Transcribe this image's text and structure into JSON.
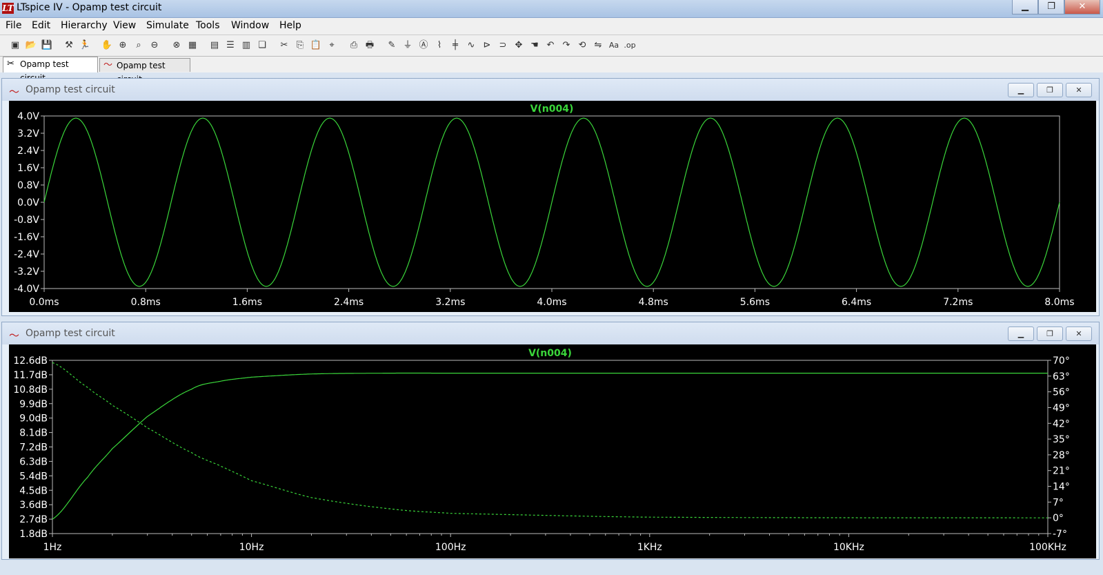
{
  "window": {
    "title": "LTspice IV - Opamp test circuit",
    "logo": "LT"
  },
  "window_buttons": [
    "▁",
    "❐",
    "✕"
  ],
  "menu": [
    "File",
    "Edit",
    "Hierarchy",
    "View",
    "Simulate",
    "Tools",
    "Window",
    "Help"
  ],
  "toolbar_icons": [
    "new-schematic-icon",
    "open-icon",
    "save-icon",
    "control-panel-icon",
    "run-icon",
    "halt-icon",
    "zoom-in-icon",
    "pan-icon",
    "zoom-out-icon",
    "zoom-fit-icon",
    "autorange-icon",
    "grid-icon",
    "tile-horizontal-icon",
    "tile-vertical-icon",
    "cascade-icon",
    "cut-icon",
    "copy-icon",
    "paste-icon",
    "find-icon",
    "print-preview-icon",
    "print-icon",
    "wire-icon",
    "ground-icon",
    "label-icon",
    "resistor-icon",
    "capacitor-icon",
    "inductor-icon",
    "diode-icon",
    "component-icon",
    "move-icon",
    "drag-icon",
    "undo-icon",
    "redo-icon",
    "rotate-icon",
    "mirror-icon",
    "text-icon",
    "spice-directive-icon"
  ],
  "tabs": [
    {
      "label": "Opamp test circuit"
    },
    {
      "label": "Opamp test circuit"
    }
  ],
  "panes": [
    {
      "title": "Opamp test circuit"
    },
    {
      "title": "Opamp test circuit"
    }
  ],
  "pane_buttons": [
    "▁",
    "❐",
    "✕"
  ],
  "chart_data": [
    {
      "type": "line",
      "title": "V(n004)",
      "x_ticks": [
        "0.0ms",
        "0.8ms",
        "1.6ms",
        "2.4ms",
        "3.2ms",
        "4.0ms",
        "4.8ms",
        "5.6ms",
        "6.4ms",
        "7.2ms",
        "8.0ms"
      ],
      "y_ticks": [
        "4.0V",
        "3.2V",
        "2.4V",
        "1.6V",
        "0.8V",
        "0.0V",
        "-0.8V",
        "-1.6V",
        "-2.4V",
        "-3.2V",
        "-4.0V"
      ],
      "xlim": [
        0,
        8
      ],
      "ylim": [
        -4,
        4
      ],
      "series": [
        {
          "name": "V(n004)",
          "amplitude": 3.9,
          "frequency_khz": 1,
          "color": "#3ad63a"
        }
      ],
      "grid": false
    },
    {
      "type": "line",
      "title": "V(n004)",
      "x_scale": "log",
      "x_ticks": [
        "1Hz",
        "10Hz",
        "100Hz",
        "1KHz",
        "10KHz",
        "100KHz"
      ],
      "y_ticks": [
        "12.6dB",
        "11.7dB",
        "10.8dB",
        "9.9dB",
        "9.0dB",
        "8.1dB",
        "7.2dB",
        "6.3dB",
        "5.4dB",
        "4.5dB",
        "3.6dB",
        "2.7dB",
        "1.8dB"
      ],
      "y2_ticks": [
        "70°",
        "63°",
        "56°",
        "49°",
        "42°",
        "35°",
        "28°",
        "21°",
        "14°",
        "7°",
        "0°",
        "-7°"
      ],
      "xlim": [
        1,
        100000
      ],
      "ylim": [
        1.8,
        12.6
      ],
      "y2lim": [
        -7,
        70
      ],
      "series": [
        {
          "name": "magnitude",
          "color": "#3ad63a",
          "style": "solid",
          "x": [
            1,
            1.5,
            2,
            3,
            5,
            7,
            10,
            20,
            50,
            100,
            1000,
            100000
          ],
          "y": [
            2.7,
            5.3,
            7.1,
            9.1,
            10.8,
            11.3,
            11.55,
            11.75,
            11.8,
            11.8,
            11.8,
            11.8
          ]
        },
        {
          "name": "phase",
          "color": "#3ad63a",
          "style": "dashed",
          "x": [
            1,
            1.5,
            2,
            3,
            5,
            7,
            10,
            20,
            50,
            100,
            1000,
            100000
          ],
          "y": [
            69,
            58,
            50,
            40,
            29,
            23,
            16.5,
            9,
            4,
            2,
            0.3,
            0
          ]
        }
      ],
      "grid": false
    }
  ]
}
